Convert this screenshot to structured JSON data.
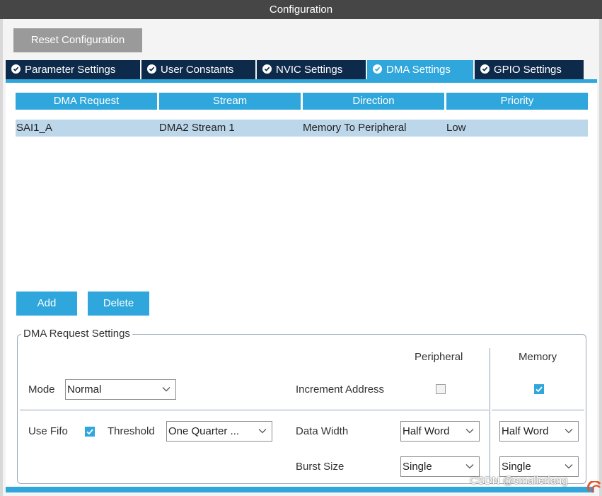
{
  "window": {
    "title": "Configuration"
  },
  "toolbar": {
    "reset_label": "Reset Configuration"
  },
  "tabs": [
    {
      "label": "Parameter Settings",
      "active": false,
      "icon": "check-circle-icon"
    },
    {
      "label": "User Constants",
      "active": false,
      "icon": "check-circle-icon"
    },
    {
      "label": "NVIC Settings",
      "active": false,
      "icon": "check-circle-icon"
    },
    {
      "label": "DMA Settings",
      "active": true,
      "icon": "check-circle-icon"
    },
    {
      "label": "GPIO Settings",
      "active": false,
      "icon": "check-circle-icon"
    }
  ],
  "table": {
    "headers": [
      "DMA Request",
      "Stream",
      "Direction",
      "Priority"
    ],
    "rows": [
      [
        "SAI1_A",
        "DMA2 Stream 1",
        "Memory To Peripheral",
        "Low"
      ]
    ]
  },
  "actions": {
    "add_label": "Add",
    "delete_label": "Delete"
  },
  "settings": {
    "legend": "DMA Request Settings",
    "peripheral_header": "Peripheral",
    "memory_header": "Memory",
    "mode": {
      "label": "Mode",
      "value": "Normal"
    },
    "increment_address": {
      "label": "Increment Address",
      "peripheral_checked": false,
      "memory_checked": true
    },
    "use_fifo": {
      "label": "Use Fifo",
      "checked": true
    },
    "threshold": {
      "label": "Threshold",
      "value": "One Quarter ..."
    },
    "data_width": {
      "label": "Data Width",
      "peripheral_value": "Half Word",
      "memory_value": "Half Word"
    },
    "burst_size": {
      "label": "Burst Size",
      "peripheral_value": "Single",
      "memory_value": "Single"
    }
  },
  "watermark": "CSDN @smallerlang",
  "colors": {
    "accent": "#2fa6dc",
    "tab_dark": "#0e2a4a",
    "title_bar": "#464646",
    "row_selected": "#bdd7ea",
    "reset_button": "#9a9a9a"
  }
}
